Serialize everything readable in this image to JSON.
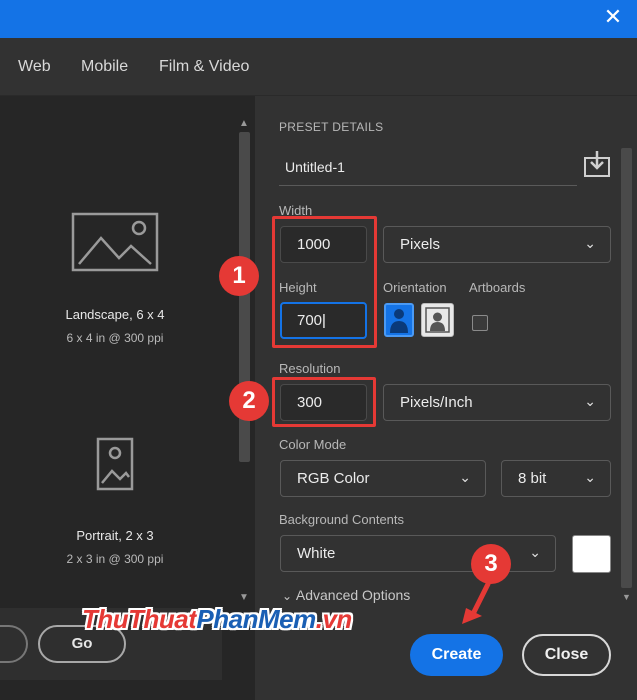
{
  "titlebar": {
    "close_glyph": "✕",
    "close_icon": "close-icon"
  },
  "tabs": [
    "Web",
    "Mobile",
    "Film & Video"
  ],
  "presets": [
    {
      "title": "Landscape, 6 x 4",
      "subtitle": "6 x 4 in @ 300 ppi",
      "icon": "landscape-image-icon"
    },
    {
      "title": "Portrait, 2 x 3",
      "subtitle": "2 x 3 in @ 300 ppi",
      "icon": "portrait-image-icon"
    }
  ],
  "left_footer": {
    "go_label": "Go"
  },
  "details": {
    "section_title": "PRESET DETAILS",
    "document_name": "Untitled-1",
    "save_icon": "save-preset-icon",
    "width_label": "Width",
    "width_value": "1000",
    "width_unit": "Pixels",
    "height_label": "Height",
    "height_value": "700",
    "orientation_label": "Orientation",
    "artboards_label": "Artboards",
    "artboards_checked": false,
    "orientation_selected": "portrait",
    "resolution_label": "Resolution",
    "resolution_value": "300",
    "resolution_unit": "Pixels/Inch",
    "color_mode_label": "Color Mode",
    "color_mode_value": "RGB Color",
    "bit_depth_value": "8 bit",
    "background_label": "Background Contents",
    "background_value": "White",
    "background_swatch": "#ffffff",
    "advanced_label": "Advanced Options"
  },
  "actions": {
    "create_label": "Create",
    "close_label": "Close"
  },
  "annotations": {
    "badge_1": "1",
    "badge_2": "2",
    "badge_3": "3",
    "color": "#e53935"
  },
  "watermark": {
    "part_a": "ThuThuat",
    "part_b": "PhanMem",
    "part_c": ".vn"
  },
  "colors": {
    "accent": "#1473e6",
    "panel": "#323232",
    "left_panel": "#262626"
  }
}
